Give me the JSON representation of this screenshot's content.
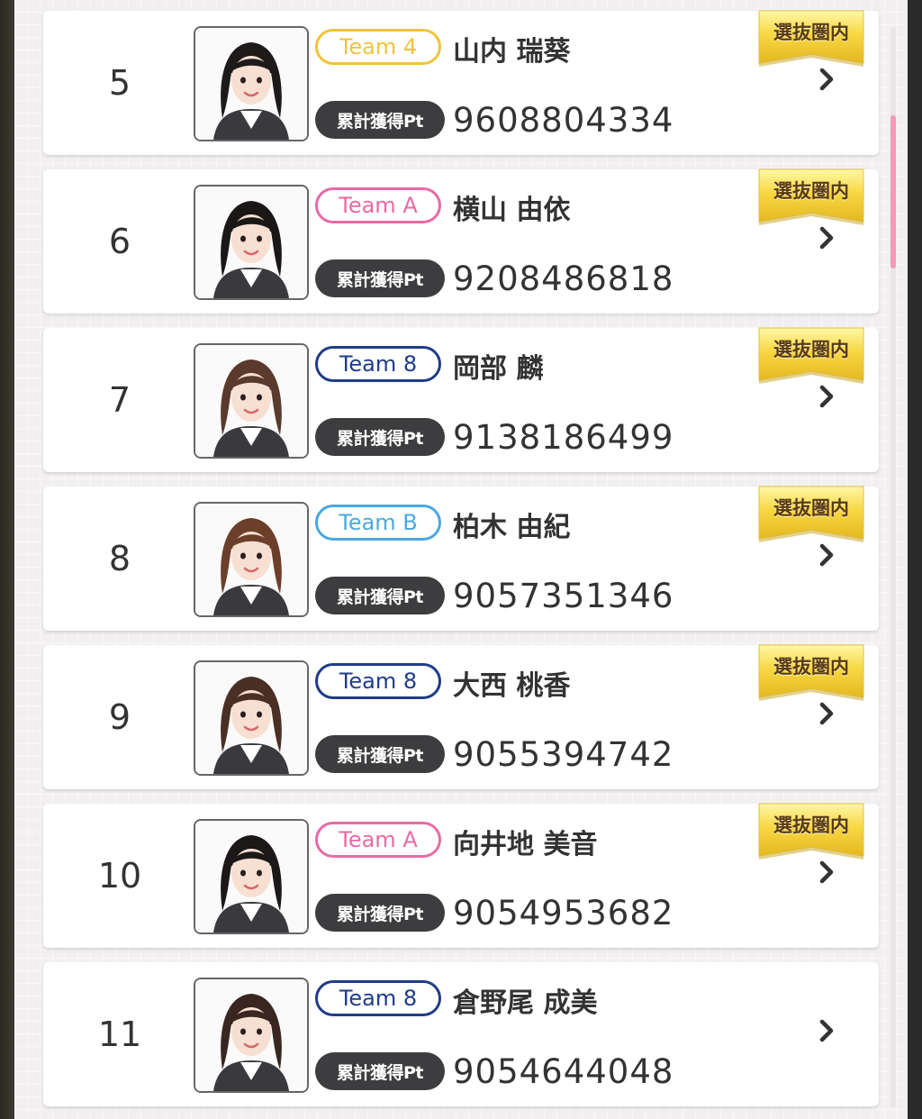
{
  "colors": {
    "team_4": "#f0c33a",
    "team_a": "#e86aa4",
    "team_8": "#1f3c88",
    "team_b": "#4aa8e0",
    "pt_label_bg": "#3d3d3f",
    "ribbon_gold": "#f7d843",
    "scroll_thumb": "#f29ab8"
  },
  "ranking": [
    {
      "rank": "5",
      "team": "Team 4",
      "team_key": "team_4",
      "name": "山内 瑞葵",
      "pt_label": "累計獲得Pt",
      "points": "9608804334",
      "badge": "選抜圏内",
      "hair": "#1e1a1a"
    },
    {
      "rank": "6",
      "team": "Team A",
      "team_key": "team_a",
      "name": "横山 由依",
      "pt_label": "累計獲得Pt",
      "points": "9208486818",
      "badge": "選抜圏内",
      "hair": "#1b1717"
    },
    {
      "rank": "7",
      "team": "Team 8",
      "team_key": "team_8",
      "name": "岡部 麟",
      "pt_label": "累計獲得Pt",
      "points": "9138186499",
      "badge": "選抜圏内",
      "hair": "#5a3a2c"
    },
    {
      "rank": "8",
      "team": "Team B",
      "team_key": "team_b",
      "name": "柏木 由紀",
      "pt_label": "累計獲得Pt",
      "points": "9057351346",
      "badge": "選抜圏内",
      "hair": "#6b3f2a"
    },
    {
      "rank": "9",
      "team": "Team 8",
      "team_key": "team_8",
      "name": "大西 桃香",
      "pt_label": "累計獲得Pt",
      "points": "9055394742",
      "badge": "選抜圏内",
      "hair": "#4a2f24"
    },
    {
      "rank": "10",
      "team": "Team A",
      "team_key": "team_a",
      "name": "向井地 美音",
      "pt_label": "累計獲得Pt",
      "points": "9054953682",
      "badge": "選抜圏内",
      "hair": "#1d1818"
    },
    {
      "rank": "11",
      "team": "Team 8",
      "team_key": "team_8",
      "name": "倉野尾 成美",
      "pt_label": "累計獲得Pt",
      "points": "9054644048",
      "badge": "",
      "hair": "#3a2620"
    }
  ],
  "icons": {
    "chevron": "chevron-right-icon",
    "photo": "member-photo"
  }
}
